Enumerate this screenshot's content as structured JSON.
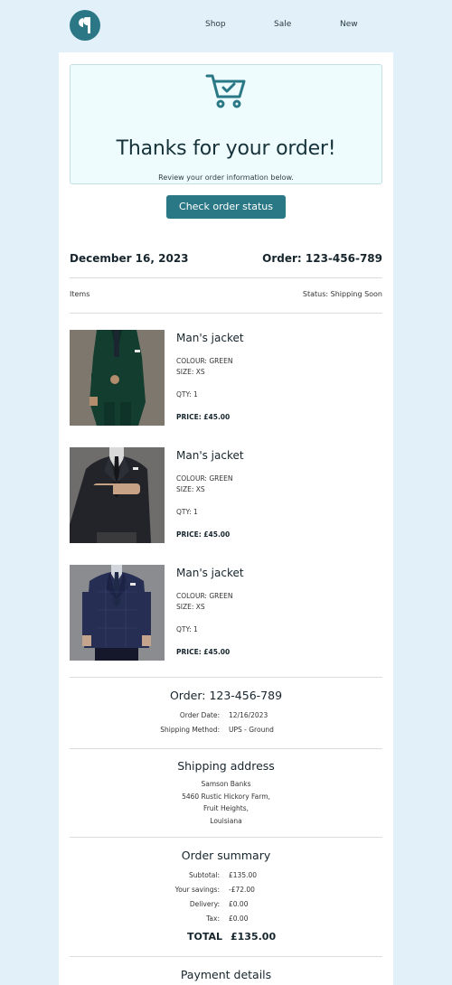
{
  "nav": {
    "items": [
      "Shop",
      "Sale",
      "New"
    ]
  },
  "hero": {
    "icon": "shopping-cart-check-icon",
    "title": "Thanks for your order!",
    "subtitle": "Review your order information below."
  },
  "cta": {
    "label": "Check order status"
  },
  "order_header": {
    "date": "December 16, 2023",
    "order": "Order: 123-456-789",
    "items_label": "Items",
    "status": "Status: Shipping Soon"
  },
  "items": [
    {
      "name": "Man's jacket",
      "colour": "COLOUR: GREEN",
      "size": "SIZE: XS",
      "qty": "QTY: 1",
      "price": "PRICE: £45.00"
    },
    {
      "name": "Man's jacket",
      "colour": "COLOUR: GREEN",
      "size": "SIZE: XS",
      "qty": "QTY: 1",
      "price": "PRICE: £45.00"
    },
    {
      "name": "Man's jacket",
      "colour": "COLOUR: GREEN",
      "size": "SIZE: XS",
      "qty": "QTY: 1",
      "price": "PRICE: £45.00"
    }
  ],
  "order_info": {
    "title": "Order: 123-456-789",
    "date_label": "Order Date:",
    "date_value": "12/16/2023",
    "shipping_label": "Shipping Method:",
    "shipping_value": "UPS - Ground"
  },
  "shipping": {
    "title": "Shipping address",
    "lines": [
      "Samson Banks",
      "5460 Rustic Hickory Farm,",
      "Fruit Heights,",
      "Louisiana"
    ]
  },
  "summary": {
    "title": "Order summary",
    "subtotal_label": "Subtotal:",
    "subtotal": "£135.00",
    "savings_label": "Your savings:",
    "savings": "-£72.00",
    "delivery_label": "Delivery:",
    "delivery": "£0.00",
    "tax_label": "Tax:",
    "tax": "£0.00",
    "total_label": "TOTAL",
    "total": "£135.00"
  },
  "payment": {
    "title": "Payment details"
  },
  "colors": {
    "accent": "#2a7886",
    "page_bg": "#e2f1f9",
    "hero_bg": "#effcfd"
  }
}
